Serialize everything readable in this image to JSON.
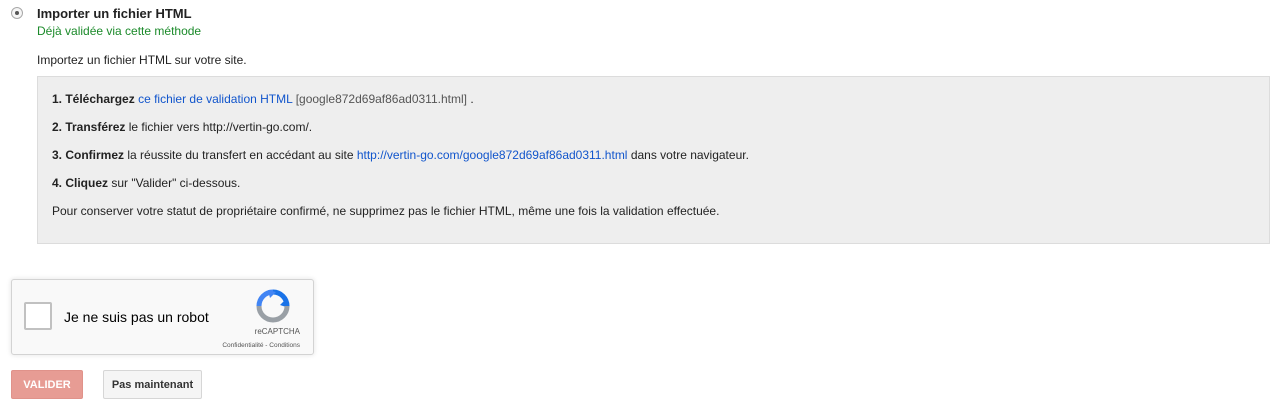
{
  "method": {
    "title": "Importer un fichier HTML",
    "status": "Déjà validée via cette méthode",
    "intro": "Importez un fichier HTML sur votre site."
  },
  "steps": {
    "s1": {
      "num_bold": "1. Téléchargez",
      "link": "ce fichier de validation HTML",
      "filename": "[google872d69af86ad0311.html]",
      "tail": "."
    },
    "s2": {
      "num_bold": "2. Transférez",
      "text": "le fichier vers http://vertin-go.com/."
    },
    "s3": {
      "num_bold": "3. Confirmez",
      "text": "la réussite du transfert en accédant au site",
      "link": "http://vertin-go.com/google872d69af86ad0311.html",
      "tail": "dans votre navigateur."
    },
    "s4": {
      "num_bold": "4. Cliquez",
      "text": "sur \"Valider\" ci-dessous."
    },
    "note": "Pour conserver votre statut de propriétaire confirmé, ne supprimez pas le fichier HTML, même une fois la validation effectuée."
  },
  "recaptcha": {
    "label": "Je ne suis pas un robot",
    "brand": "reCAPTCHA",
    "terms": "Confidentialité - Conditions"
  },
  "buttons": {
    "verify": "VALIDER",
    "later": "Pas maintenant"
  },
  "colors": {
    "link": "#1155cc",
    "success": "#1b8a2a",
    "verify_button": "#e79c94"
  },
  "icons": {
    "radio": "radio-selected-icon",
    "recaptcha": "recaptcha-logo-icon"
  }
}
